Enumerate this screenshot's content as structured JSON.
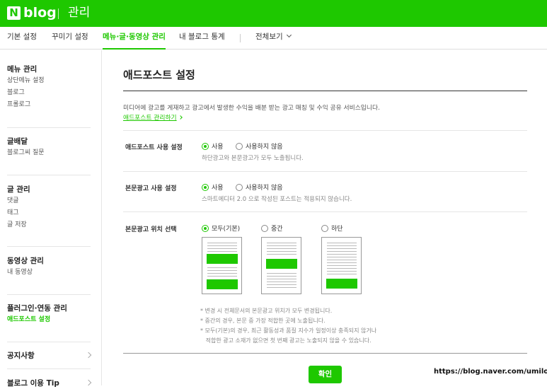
{
  "header": {
    "logo_letter": "N",
    "logo_text": "blog",
    "section_title": "관리",
    "brand_color": "#1ec800"
  },
  "tabs": [
    {
      "label": "기본 설정"
    },
    {
      "label": "꾸미기 설정"
    },
    {
      "label": "메뉴·글·동영상 관리",
      "active": true
    },
    {
      "label": "내 블로그 통계"
    },
    {
      "label": "전체보기"
    }
  ],
  "sidebar": {
    "groups": [
      {
        "title": "메뉴 관리",
        "items": [
          "상단메뉴 설정",
          "블로그",
          "프롤로그"
        ]
      },
      {
        "title": "글배달",
        "items": [
          "블로그씨 질문"
        ]
      },
      {
        "title": "글 관리",
        "items": [
          "댓글",
          "태그",
          "글 저장"
        ]
      },
      {
        "title": "동영상 관리",
        "items": [
          "내 동영상"
        ]
      },
      {
        "title": "플러그인·연동 관리",
        "items": [
          "애드포스트 설정"
        ],
        "active_item": "애드포스트 설정"
      },
      {
        "title": "공지사항",
        "items": []
      },
      {
        "title": "블로그 이용 Tip",
        "items": []
      }
    ]
  },
  "main": {
    "title": "애드포스트 설정",
    "intro": "미디어에 광고를 게재하고 광고에서 발생한 수익을 배분 받는 광고 매칭 및 수익 공유 서비스입니다.",
    "intro_link": "애드포스트 관리하기",
    "rows": [
      {
        "label": "애드포스트 사용 설정",
        "options": [
          "사용",
          "사용하지 않음"
        ],
        "selected": "사용",
        "desc": "하단광고와 본문광고가 모두 노출됩니다."
      },
      {
        "label": "본문광고 사용 설정",
        "options": [
          "사용",
          "사용하지 않음"
        ],
        "selected": "사용",
        "desc": "스마트에디터 2.0 으로 작성된 포스트는 적용되지 않습니다."
      },
      {
        "label": "본문광고 위치 선택",
        "options": [
          "모두(기본)",
          "중간",
          "하단"
        ],
        "selected": "모두(기본)"
      }
    ],
    "notes": [
      "* 변경 시 전체문서의 본문광고 위치가 모두 변경됩니다.",
      "* 중간의 경우, 본문 중 가장 적합한 곳에 노출됩니다.",
      "* 모두(기본)의 경우, 최근 활동성과 품질 지수가 일정이상 충족되지 않거나",
      "   적합한 광고 소재가 없으면 첫 번째 광고는 노출되지 않을 수 있습니다."
    ],
    "confirm_label": "확인"
  },
  "watermark": "https://blog.naver.com/umilog"
}
